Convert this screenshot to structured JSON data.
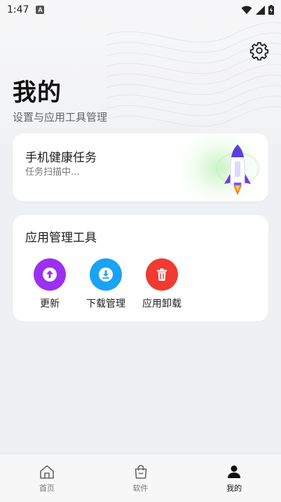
{
  "status_bar": {
    "time": "1:47",
    "badge": "A"
  },
  "header": {
    "title": "我的",
    "subtitle": "设置与应用工具管理",
    "settings_icon": "gear-icon"
  },
  "health_card": {
    "title": "手机健康任务",
    "status": "任务扫描中...",
    "icon": "rocket-icon"
  },
  "tools_card": {
    "title": "应用管理工具",
    "items": [
      {
        "label": "更新",
        "icon": "arrow-up-icon",
        "color": "#9c2ff0"
      },
      {
        "label": "下载管理",
        "icon": "download-icon",
        "color": "#1aa2f5"
      },
      {
        "label": "应用卸载",
        "icon": "trash-icon",
        "color": "#ef3b32"
      }
    ]
  },
  "bottom_nav": {
    "items": [
      {
        "label": "首页",
        "icon": "home-icon",
        "active": false
      },
      {
        "label": "软件",
        "icon": "shopping-bag-icon",
        "active": false
      },
      {
        "label": "我的",
        "icon": "person-icon",
        "active": true
      }
    ]
  }
}
